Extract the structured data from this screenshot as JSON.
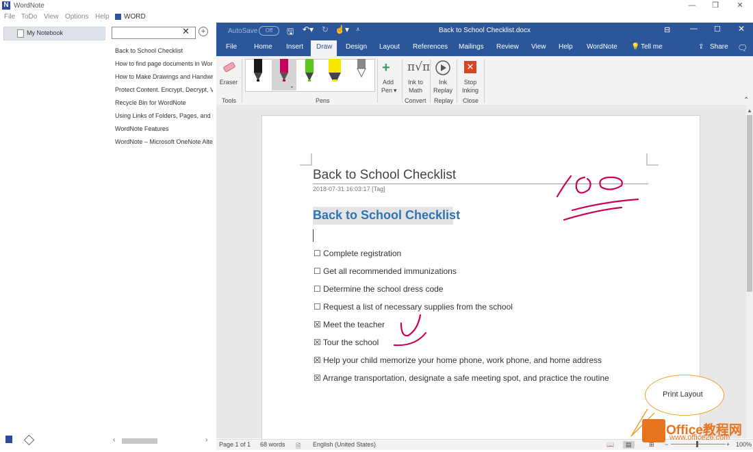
{
  "wordnote": {
    "app_title": "WordNote",
    "logo_letter": "N",
    "menu": [
      "File",
      "ToDo",
      "View",
      "Options",
      "Help"
    ],
    "word_tag": "WORD",
    "notebook": "My Notebook",
    "search_placeholder": "",
    "pages": [
      "Back to School Checklist",
      "How to find page documents in WordNote",
      "How to Make Drawings and Handwriting",
      "Protect Content. Encrypt, Decrypt, View",
      "Recycle Bin for WordNote",
      "Using Links of Folders, Pages, and Paragraphs",
      "WordNote Features",
      "WordNote – Microsoft OneNote Alternative"
    ]
  },
  "word": {
    "autosave_label": "AutoSave",
    "autosave_state": "Off",
    "doc_filename": "Back to School Checklist.docx",
    "tabs": [
      "File",
      "Home",
      "Insert",
      "Draw",
      "Design",
      "Layout",
      "References",
      "Mailings",
      "Review",
      "View",
      "Help",
      "WordNote"
    ],
    "active_tab": "Draw",
    "tell_me": "Tell me",
    "share": "Share",
    "ribbon": {
      "eraser": "Eraser",
      "tools_group": "Tools",
      "pens_group": "Pens",
      "add_pen_1": "Add",
      "add_pen_2": "Pen",
      "ink_math_1": "Ink to",
      "ink_math_2": "Math",
      "convert_group": "Convert",
      "ink_replay_1": "Ink",
      "ink_replay_2": "Replay",
      "replay_group": "Replay",
      "stop_1": "Stop",
      "stop_2": "Inking",
      "close_group": "Close"
    },
    "pens": [
      {
        "name": "black-pen",
        "color": "#1a1a1a"
      },
      {
        "name": "magenta-pen",
        "color": "#c8005a"
      },
      {
        "name": "green-pen",
        "color": "#5ac81e"
      },
      {
        "name": "yellow-highlighter",
        "color": "#f5e600"
      },
      {
        "name": "gray-pencil",
        "color": "#888888"
      }
    ]
  },
  "document": {
    "title": "Back to School Checklist",
    "date": "2018-07-31 16:03:17",
    "tag": "[Tag]",
    "heading": "Back to School Checklist",
    "checklist": [
      {
        "checked": false,
        "text": "Complete registration"
      },
      {
        "checked": false,
        "text": "Get all recommended immunizations"
      },
      {
        "checked": false,
        "text": "Determine the school dress code"
      },
      {
        "checked": false,
        "text": "Request a list of necessary supplies from the school"
      },
      {
        "checked": true,
        "text": "Meet the teacher"
      },
      {
        "checked": true,
        "text": "Tour the school"
      },
      {
        "checked": true,
        "text": "Help your child memorize your home phone, work phone, and home address"
      },
      {
        "checked": true,
        "text": "Arrange transportation, designate a safe meeting spot, and practice the routine"
      }
    ],
    "ink_color": "#c8005a"
  },
  "status": {
    "page": "Page 1 of 1",
    "words": "68 words",
    "language": "English (United States)",
    "zoom": "100%"
  },
  "callout": {
    "text": "Print Layout"
  },
  "watermark": {
    "brand": "Office教程网",
    "url": "www.office26.com"
  }
}
